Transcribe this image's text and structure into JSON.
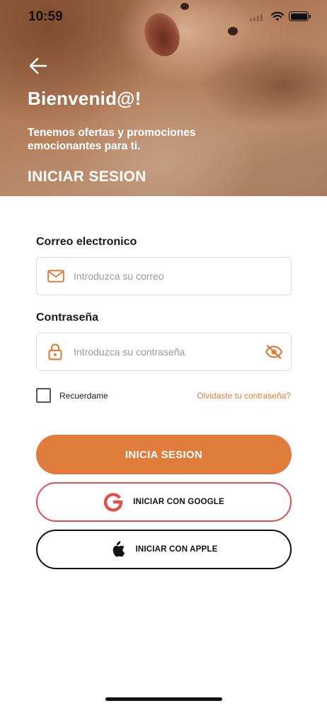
{
  "status_bar": {
    "time": "10:59"
  },
  "header": {
    "title": "Bienvenid@!",
    "subtitle": "Tenemos ofertas y promociones emocionantes para ti.",
    "section_title": "INICIAR SESION",
    "back_icon": "arrow-left-icon"
  },
  "form": {
    "email": {
      "label": "Correo electronico",
      "placeholder": "Introduzca su correo",
      "value": "",
      "icon": "mail-icon"
    },
    "password": {
      "label": "Contraseña",
      "placeholder": "Introduzca su contraseña",
      "value": "",
      "icon": "lock-icon",
      "toggle_icon": "eye-off-icon"
    },
    "remember_label": "Recuerdame",
    "remember_checked": false,
    "forgot_link": "Olvidaste tu contraseña?"
  },
  "actions": {
    "login_label": "INICIA SESION",
    "google_label": "INICIAR CON GOOGLE",
    "apple_label": "INICIAR CON APPLE"
  },
  "colors": {
    "accent": "#e07c3c",
    "google_border": "#e0504d",
    "apple_border": "#111111",
    "text_dark": "#1a1a1a"
  }
}
